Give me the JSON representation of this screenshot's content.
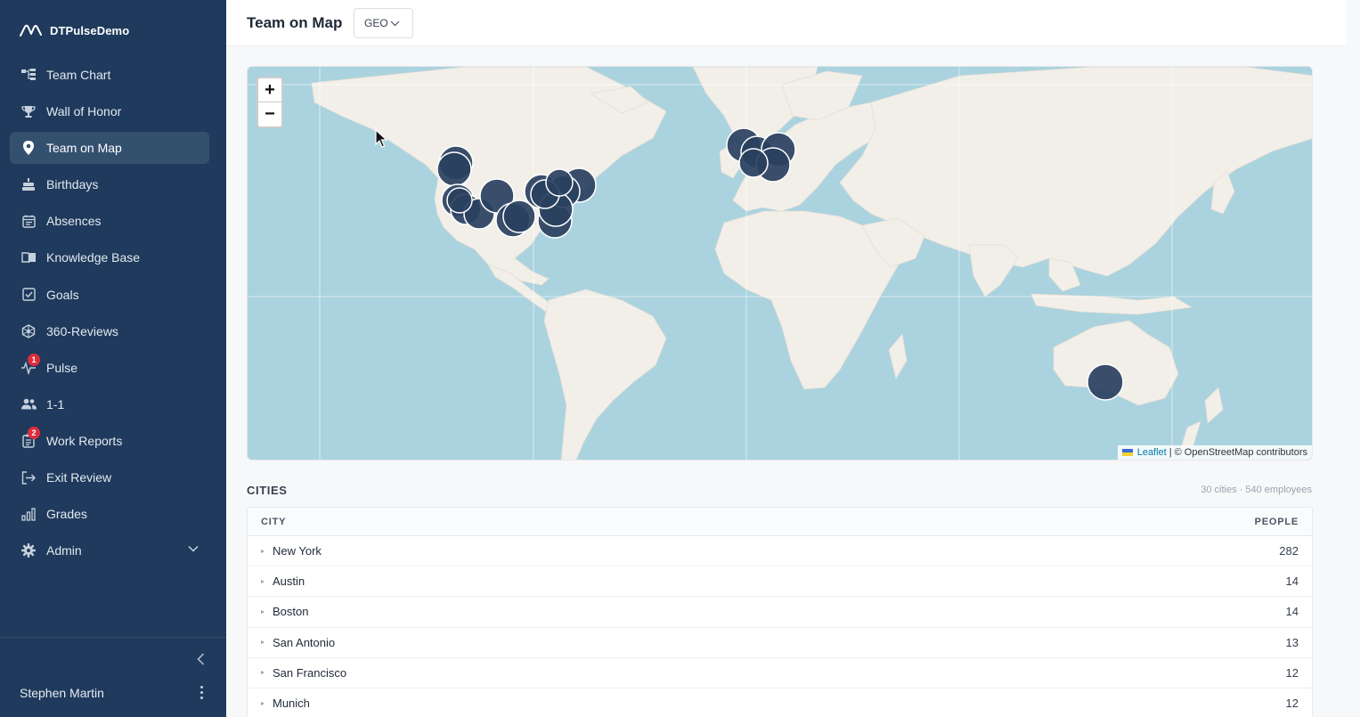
{
  "app": {
    "name": "DTPulseDemo"
  },
  "sidebar": {
    "items": [
      {
        "label": "Team Chart",
        "icon": "org-chart-icon"
      },
      {
        "label": "Wall of Honor",
        "icon": "trophy-icon"
      },
      {
        "label": "Team on Map",
        "icon": "map-pin-icon",
        "active": true
      },
      {
        "label": "Birthdays",
        "icon": "cake-icon"
      },
      {
        "label": "Absences",
        "icon": "calendar-icon"
      },
      {
        "label": "Knowledge Base",
        "icon": "book-icon"
      },
      {
        "label": "Goals",
        "icon": "checkbox-icon"
      },
      {
        "label": "360-Reviews",
        "icon": "network-icon"
      },
      {
        "label": "Pulse",
        "icon": "pulse-icon",
        "badge": "1"
      },
      {
        "label": "1-1",
        "icon": "users-icon"
      },
      {
        "label": "Work Reports",
        "icon": "clipboard-icon",
        "badge": "2"
      },
      {
        "label": "Exit Review",
        "icon": "exit-icon"
      },
      {
        "label": "Grades",
        "icon": "bar-chart-icon"
      },
      {
        "label": "Admin",
        "icon": "gear-icon",
        "expandable": true
      }
    ]
  },
  "user": {
    "name": "Stephen Martin"
  },
  "header": {
    "title": "Team on Map",
    "geo_select": "GEO"
  },
  "map": {
    "zoom_in": "+",
    "zoom_out": "−",
    "attribution": {
      "leaflet": "Leaflet",
      "rest": "| © OpenStreetMap contributors"
    }
  },
  "cities": {
    "title": "CITIES",
    "summary": "30 cities · 540 employees",
    "columns": {
      "city": "CITY",
      "people": "PEOPLE"
    },
    "rows": [
      {
        "city": "New York",
        "people": "282"
      },
      {
        "city": "Austin",
        "people": "14"
      },
      {
        "city": "Boston",
        "people": "14"
      },
      {
        "city": "San Antonio",
        "people": "13"
      },
      {
        "city": "San Francisco",
        "people": "12"
      },
      {
        "city": "Munich",
        "people": "12"
      }
    ]
  },
  "colors": {
    "sidebar": "#1f3a5c",
    "active": "#34506f",
    "marker": "#2a4060",
    "ocean": "#aad3df",
    "land": "#f2efe9",
    "badge": "#e02d3c"
  }
}
